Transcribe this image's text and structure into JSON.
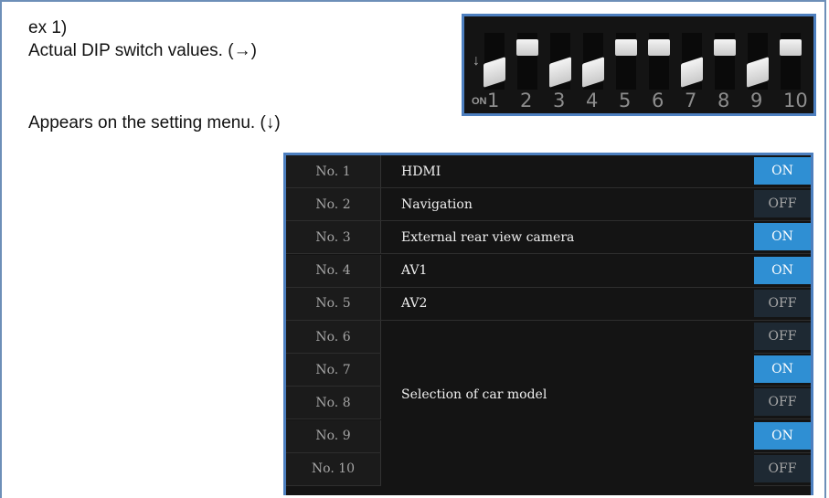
{
  "intro": {
    "example_label": "ex 1)",
    "dip_caption": "Actual DIP switch values. (→)",
    "menu_caption": "Appears on the setting menu. (↓)"
  },
  "dip_switch": {
    "on_label": "ON",
    "arrow_glyph": "↓",
    "switch_numbers": [
      "1",
      "2",
      "3",
      "4",
      "5",
      "6",
      "7",
      "8",
      "9",
      "10"
    ],
    "states": [
      "ON",
      "OFF",
      "ON",
      "ON",
      "OFF",
      "OFF",
      "ON",
      "OFF",
      "ON",
      "OFF"
    ]
  },
  "menu": {
    "rows": [
      {
        "no": "No. 1",
        "name": "HDMI",
        "value": "ON"
      },
      {
        "no": "No. 2",
        "name": "Navigation",
        "value": "OFF"
      },
      {
        "no": "No. 3",
        "name": "External rear view camera",
        "value": "ON"
      },
      {
        "no": "No. 4",
        "name": "AV1",
        "value": "ON"
      },
      {
        "no": "No. 5",
        "name": "AV2",
        "value": "OFF"
      },
      {
        "no": "No. 6",
        "name": "",
        "value": "OFF"
      },
      {
        "no": "No. 7",
        "name": "",
        "value": "ON"
      },
      {
        "no": "No. 8",
        "name": "",
        "value": "OFF"
      },
      {
        "no": "No. 9",
        "name": "",
        "value": "ON"
      },
      {
        "no": "No. 10",
        "name": "",
        "value": "OFF"
      }
    ],
    "merged_label": "Selection of car model"
  },
  "colors": {
    "on_bg": "#2f8fd3",
    "off_bg": "#1e2933",
    "frame_border": "#4d7fbf"
  }
}
